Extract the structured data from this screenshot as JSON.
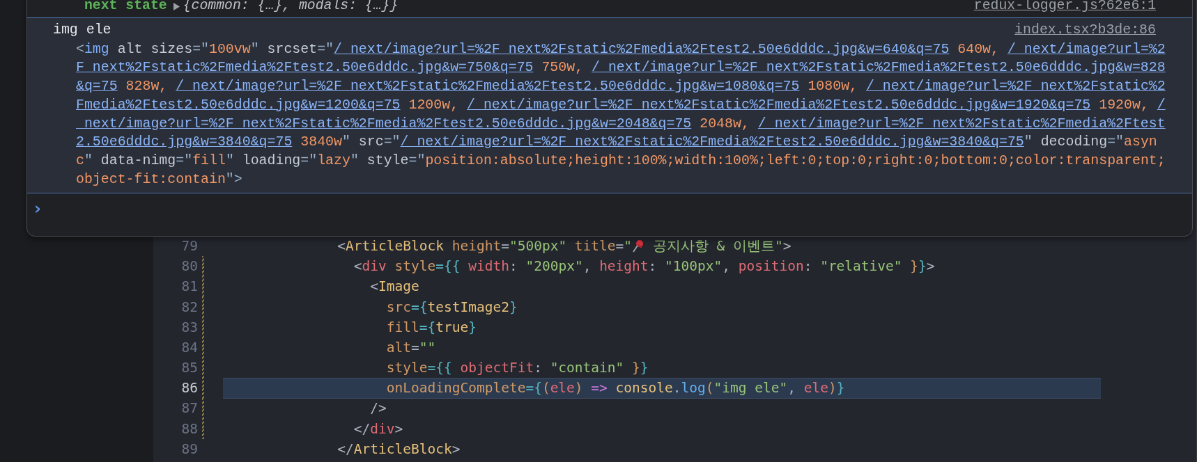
{
  "console": {
    "previous_entry": {
      "label": "next state",
      "value": "{common: {…}, modals: {…}}",
      "source": "redux-logger.js?62e6:1"
    },
    "log_entry": {
      "message": "img ele",
      "source": "index.tsx?b3de:86",
      "markup": [
        {
          "kind": "punct",
          "text": "<"
        },
        {
          "kind": "tag",
          "text": "img"
        },
        {
          "kind": "attr",
          "text": " alt sizes"
        },
        {
          "kind": "punct",
          "text": "=\""
        },
        {
          "kind": "value",
          "text": "100vw"
        },
        {
          "kind": "punct",
          "text": "\""
        },
        {
          "kind": "attr",
          "text": " srcset"
        },
        {
          "kind": "punct",
          "text": "=\""
        },
        {
          "kind": "link",
          "text": "/_next/image?url=%2F_next%2Fstatic%2Fmedia%2Ftest2.50e6dddc.jpg&w=640&q=75"
        },
        {
          "kind": "value",
          "text": " 640w, "
        },
        {
          "kind": "link",
          "text": "/_next/image?url=%2F_next%2Fstatic%2Fmedia%2Ftest2.50e6dddc.jpg&w=750&q=75"
        },
        {
          "kind": "value",
          "text": " 750w, "
        },
        {
          "kind": "link",
          "text": "/_next/image?url=%2F_next%2Fstatic%2Fmedia%2Ftest2.50e6dddc.jpg&w=828&q=75"
        },
        {
          "kind": "value",
          "text": " 828w, "
        },
        {
          "kind": "link",
          "text": "/_next/image?url=%2F_next%2Fstatic%2Fmedia%2Ftest2.50e6dddc.jpg&w=1080&q=75"
        },
        {
          "kind": "value",
          "text": " 1080w, "
        },
        {
          "kind": "link",
          "text": "/_next/image?url=%2F_next%2Fstatic%2Fmedia%2Ftest2.50e6dddc.jpg&w=1200&q=75"
        },
        {
          "kind": "value",
          "text": " 1200w, "
        },
        {
          "kind": "link",
          "text": "/_next/image?url=%2F_next%2Fstatic%2Fmedia%2Ftest2.50e6dddc.jpg&w=1920&q=75"
        },
        {
          "kind": "value",
          "text": " 1920w, "
        },
        {
          "kind": "link",
          "text": "/_next/image?url=%2F_next%2Fstatic%2Fmedia%2Ftest2.50e6dddc.jpg&w=2048&q=75"
        },
        {
          "kind": "value",
          "text": " 2048w, "
        },
        {
          "kind": "link",
          "text": "/_next/image?url=%2F_next%2Fstatic%2Fmedia%2Ftest2.50e6dddc.jpg&w=3840&q=75"
        },
        {
          "kind": "value",
          "text": " 3840w"
        },
        {
          "kind": "punct",
          "text": "\""
        },
        {
          "kind": "attr",
          "text": " src"
        },
        {
          "kind": "punct",
          "text": "=\""
        },
        {
          "kind": "link",
          "text": "/_next/image?url=%2F_next%2Fstatic%2Fmedia%2Ftest2.50e6dddc.jpg&w=3840&q=75"
        },
        {
          "kind": "punct",
          "text": "\""
        },
        {
          "kind": "attr",
          "text": " decoding"
        },
        {
          "kind": "punct",
          "text": "=\""
        },
        {
          "kind": "value",
          "text": "async"
        },
        {
          "kind": "punct",
          "text": "\""
        },
        {
          "kind": "attr",
          "text": " data-nimg"
        },
        {
          "kind": "punct",
          "text": "=\""
        },
        {
          "kind": "value",
          "text": "fill"
        },
        {
          "kind": "punct",
          "text": "\""
        },
        {
          "kind": "attr",
          "text": " loading"
        },
        {
          "kind": "punct",
          "text": "=\""
        },
        {
          "kind": "value",
          "text": "lazy"
        },
        {
          "kind": "punct",
          "text": "\""
        },
        {
          "kind": "attr",
          "text": " style"
        },
        {
          "kind": "punct",
          "text": "=\""
        },
        {
          "kind": "value",
          "text": "position:absolute;height:100%;width:100%;left:0;top:0;right:0;bottom:0;color:transparent;object-fit:contain"
        },
        {
          "kind": "punct",
          "text": "\">"
        }
      ]
    },
    "prompt": "›"
  },
  "editor": {
    "lines": [
      {
        "number": "79",
        "current": false,
        "tokens": [
          {
            "kind": "punct",
            "text": "              <"
          },
          {
            "kind": "tag",
            "text": "ArticleBlock"
          },
          {
            "kind": "attr",
            "text": " height"
          },
          {
            "kind": "punct",
            "text": "="
          },
          {
            "kind": "string",
            "text": "\"500px\""
          },
          {
            "kind": "attr",
            "text": " title"
          },
          {
            "kind": "punct",
            "text": "="
          },
          {
            "kind": "string",
            "text": "\""
          },
          {
            "kind": "pin_icon"
          },
          {
            "kind": "string",
            "text": " 공지사항 & 이벤트\""
          },
          {
            "kind": "punct",
            "text": ">"
          }
        ]
      },
      {
        "number": "80",
        "current": false,
        "tokens": [
          {
            "kind": "punct",
            "text": "                <"
          },
          {
            "kind": "html_tag",
            "text": "div"
          },
          {
            "kind": "attr",
            "text": " style"
          },
          {
            "kind": "brace",
            "text": "={{"
          },
          {
            "kind": "key",
            "text": " width"
          },
          {
            "kind": "punct",
            "text": ": "
          },
          {
            "kind": "string",
            "text": "\"200px\""
          },
          {
            "kind": "punct",
            "text": ", "
          },
          {
            "kind": "key",
            "text": "height"
          },
          {
            "kind": "punct",
            "text": ": "
          },
          {
            "kind": "string",
            "text": "\"100px\""
          },
          {
            "kind": "punct",
            "text": ", "
          },
          {
            "kind": "key",
            "text": "position"
          },
          {
            "kind": "punct",
            "text": ": "
          },
          {
            "kind": "string",
            "text": "\"relative\""
          },
          {
            "kind": "bracket",
            "text": " }"
          },
          {
            "kind": "brace",
            "text": "}"
          },
          {
            "kind": "punct",
            "text": ">"
          }
        ]
      },
      {
        "number": "81",
        "current": false,
        "tokens": [
          {
            "kind": "punct",
            "text": "                  <"
          },
          {
            "kind": "tag",
            "text": "Image"
          }
        ]
      },
      {
        "number": "82",
        "current": false,
        "tokens": [
          {
            "kind": "attr",
            "text": "                    src"
          },
          {
            "kind": "brace",
            "text": "={"
          },
          {
            "kind": "ident",
            "text": "testImage2"
          },
          {
            "kind": "brace",
            "text": "}"
          }
        ]
      },
      {
        "number": "83",
        "current": false,
        "tokens": [
          {
            "kind": "attr",
            "text": "                    fill"
          },
          {
            "kind": "brace",
            "text": "={"
          },
          {
            "kind": "ident",
            "text": "true"
          },
          {
            "kind": "brace",
            "text": "}"
          }
        ]
      },
      {
        "number": "84",
        "current": false,
        "tokens": [
          {
            "kind": "attr",
            "text": "                    alt"
          },
          {
            "kind": "punct",
            "text": "="
          },
          {
            "kind": "string",
            "text": "\"\""
          }
        ]
      },
      {
        "number": "85",
        "current": false,
        "tokens": [
          {
            "kind": "attr",
            "text": "                    style"
          },
          {
            "kind": "brace",
            "text": "={{"
          },
          {
            "kind": "key",
            "text": " objectFit"
          },
          {
            "kind": "punct",
            "text": ": "
          },
          {
            "kind": "string",
            "text": "\"contain\""
          },
          {
            "kind": "bracket",
            "text": " }"
          },
          {
            "kind": "brace",
            "text": "}"
          }
        ]
      },
      {
        "number": "86",
        "current": true,
        "tokens": [
          {
            "kind": "attr",
            "text": "                    onLoadingComplete"
          },
          {
            "kind": "brace",
            "text": "={"
          },
          {
            "kind": "bracket",
            "text": "("
          },
          {
            "kind": "param",
            "text": "ele"
          },
          {
            "kind": "bracket",
            "text": ")"
          },
          {
            "kind": "keyword",
            "text": " =>"
          },
          {
            "kind": "ident",
            "text": " console"
          },
          {
            "kind": "punct",
            "text": "."
          },
          {
            "kind": "fn",
            "text": "log"
          },
          {
            "kind": "bracket",
            "text": "("
          },
          {
            "kind": "string",
            "text": "\"img ele\""
          },
          {
            "kind": "punct",
            "text": ", "
          },
          {
            "kind": "param",
            "text": "ele"
          },
          {
            "kind": "bracket",
            "text": ")"
          },
          {
            "kind": "brace",
            "text": "}"
          }
        ]
      },
      {
        "number": "87",
        "current": false,
        "tokens": [
          {
            "kind": "punct",
            "text": "                  />"
          }
        ]
      },
      {
        "number": "88",
        "current": false,
        "tokens": [
          {
            "kind": "punct",
            "text": "                </"
          },
          {
            "kind": "html_tag",
            "text": "div"
          },
          {
            "kind": "punct",
            "text": ">"
          }
        ]
      },
      {
        "number": "89",
        "current": false,
        "tokens": [
          {
            "kind": "punct",
            "text": "              </"
          },
          {
            "kind": "tag",
            "text": "ArticleBlock"
          },
          {
            "kind": "punct",
            "text": ">"
          }
        ]
      }
    ]
  }
}
